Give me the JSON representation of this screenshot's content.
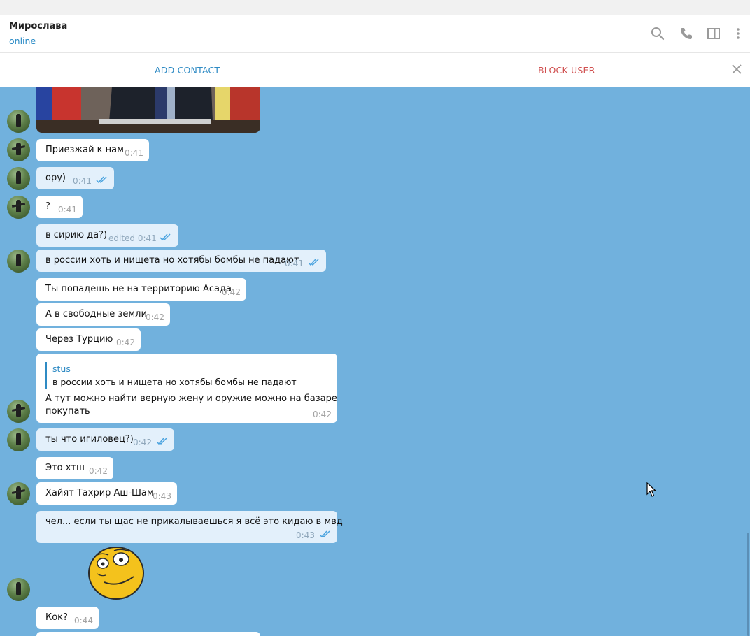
{
  "header": {
    "peer_name": "Мирослава",
    "peer_status": "online",
    "icons": [
      "search-icon",
      "phone-icon",
      "sidebar-toggle-icon",
      "more-vert-icon"
    ]
  },
  "action_bar": {
    "add_contact": "ADD CONTACT",
    "block_user": "BLOCK USER"
  },
  "messages": [
    {
      "text": "Приезжай к нам",
      "time": "0:41",
      "dir": "in"
    },
    {
      "text": "ору)",
      "time": "0:41",
      "dir": "out"
    },
    {
      "text": "?",
      "time": "0:41",
      "dir": "in"
    },
    {
      "text": "в сирию да?)",
      "time": "edited 0:41",
      "dir": "out"
    },
    {
      "text": "в россии хоть и нищета но хотябы бомбы не падают",
      "time": "0:41",
      "dir": "out"
    },
    {
      "text": "Ты попадешь не на территорию Асада",
      "time": "0:42",
      "dir": "in"
    },
    {
      "text": "А в свободные земли",
      "time": "0:42",
      "dir": "in"
    },
    {
      "text": "Через Турцию",
      "time": "0:42",
      "dir": "in"
    },
    {
      "reply_name": "stus",
      "reply_text": "в россии хоть и нищета но хотябы бомбы не падают",
      "text_line1": "А тут можно найти верную жену и оружие можно на базаре",
      "text_line2": "покупать",
      "time": "0:42",
      "dir": "in"
    },
    {
      "text": "ты что игиловец?)",
      "time": "0:42",
      "dir": "out"
    },
    {
      "text": "Это хтш",
      "time": "0:42",
      "dir": "in"
    },
    {
      "text": "Хайят Тахрир Аш-Шам",
      "time": "0:43",
      "dir": "in"
    },
    {
      "text": "чел... если ты щас не прикалываешься я всё это кидаю в мвд",
      "time": "0:43",
      "dir": "out"
    },
    {
      "sticker": "smiley-face-sticker",
      "dir": "in"
    },
    {
      "text": "Кок?",
      "time": "0:44",
      "dir": "in"
    }
  ],
  "colors": {
    "chat_background": "#71b1dd",
    "accent": "#2f8bc4",
    "danger": "#d05050",
    "incoming_bubble": "#ffffff",
    "outgoing_bubble": "#e3f0fb"
  }
}
